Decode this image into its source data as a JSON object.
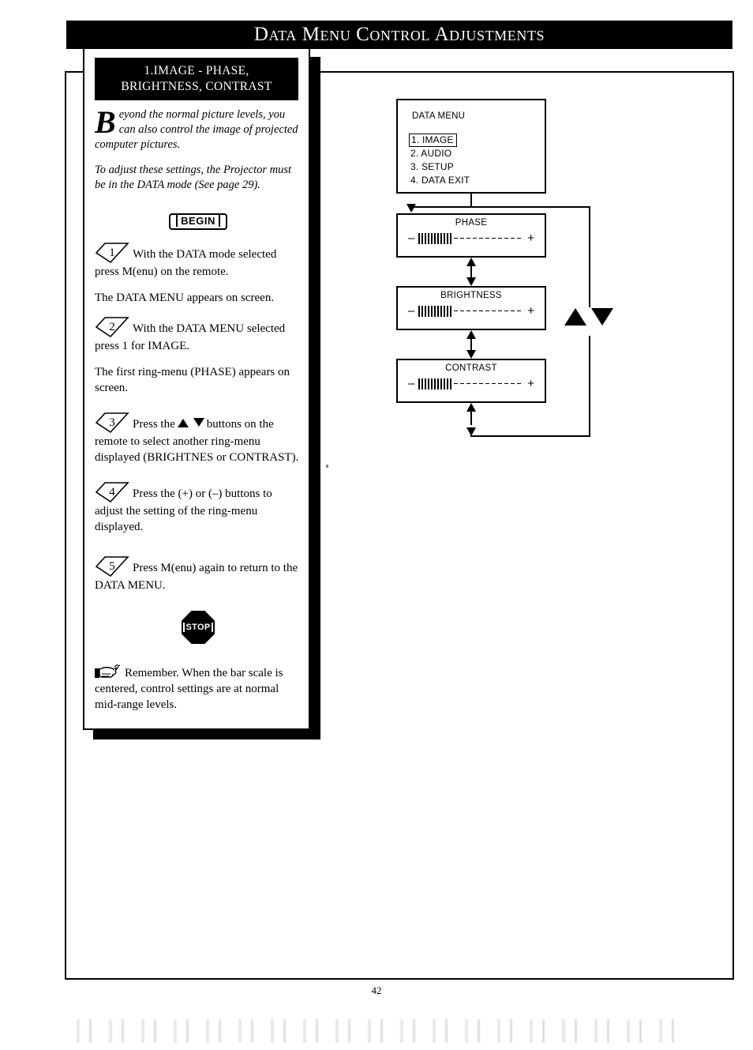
{
  "header": {
    "title": "Data Menu Control Adjustments"
  },
  "card": {
    "title_line1": "1.IMAGE - PHASE,",
    "title_line2": "BRIGHTNESS, CONTRAST",
    "dropcap": "B",
    "intro_1": "eyond the normal picture levels, you can also control the image of projected computer pictures.",
    "intro_2": "To adjust these settings, the Projector must be in the DATA mode (See page 29).",
    "begin_label": "BEGIN",
    "steps": [
      {
        "num": "1",
        "text_a": "With the DATA mode selected press M(enu) on the remote.",
        "note": "The DATA MENU appears on screen."
      },
      {
        "num": "2",
        "text_a": "With the DATA MENU selected press 1 for IMAGE.",
        "note": "The first ring-menu (PHASE) appears on screen."
      },
      {
        "num": "3",
        "text_a": "Press the",
        "text_b": "buttons on the remote to select another ring-menu displayed (BRIGHTNES or CONTRAST).",
        "note": ""
      },
      {
        "num": "4",
        "text_a": "Press the (+) or (–) buttons to adjust the setting of the ring-menu displayed.",
        "note": ""
      },
      {
        "num": "5",
        "text_a": "Press M(enu) again to return to the DATA MENU.",
        "note": ""
      }
    ],
    "stop_label": "STOP",
    "remember": "Remember. When the bar scale is centered, control settings are at normal mid-range levels."
  },
  "diagram": {
    "menu": {
      "title": "DATA MENU",
      "items": [
        {
          "label": "1. IMAGE",
          "selected": true
        },
        {
          "label": "2. AUDIO",
          "selected": false
        },
        {
          "label": "3. SETUP",
          "selected": false
        },
        {
          "label": "4. DATA EXIT",
          "selected": false
        }
      ]
    },
    "ring_menus": [
      {
        "label": "PHASE",
        "minus": "–",
        "plus": "+",
        "filled": 11,
        "empty": 11
      },
      {
        "label": "BRIGHTNESS",
        "minus": "–",
        "plus": "+",
        "filled": 11,
        "empty": 11
      },
      {
        "label": "CONTRAST",
        "minus": "–",
        "plus": "+",
        "filled": 11,
        "empty": 11
      }
    ],
    "nav_icons": [
      "triangle-up-icon",
      "triangle-down-icon"
    ]
  },
  "footer": {
    "page_number": "42"
  }
}
